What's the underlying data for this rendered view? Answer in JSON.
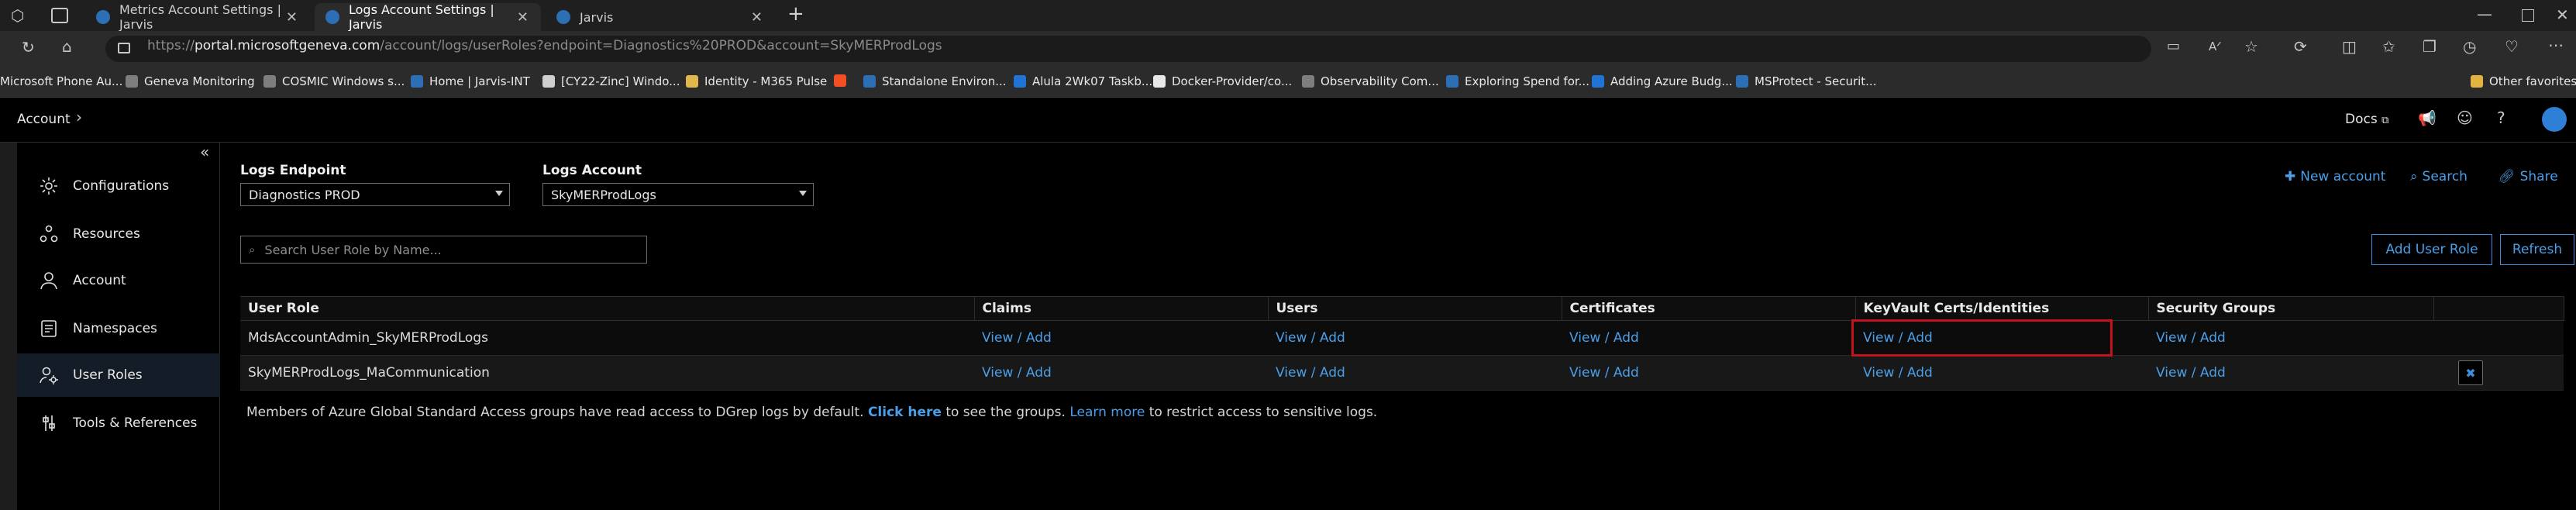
{
  "browser": {
    "tabs": [
      {
        "label": "Metrics Account Settings | Jarvis",
        "active": false
      },
      {
        "label": "Logs Account Settings | Jarvis",
        "active": true
      },
      {
        "label": "Jarvis",
        "active": false
      }
    ],
    "new_tab": "+",
    "url_prefix": "https://",
    "url_host": "portal.microsoftgeneva.com",
    "url_path": "/account/logs/userRoles?endpoint=Diagnostics%20PROD&account=SkyMERProdLogs",
    "favorites": [
      {
        "label": "Microsoft Phone Au...",
        "color": "#d84f2a"
      },
      {
        "label": "Geneva Monitoring",
        "color": "#7e7e7e"
      },
      {
        "label": "COSMIC Windows s...",
        "color": "#7e7e7e"
      },
      {
        "label": "Home | Jarvis-INT",
        "color": "#2d6fb5"
      },
      {
        "label": "[CY22-Zinc] Windo...",
        "color": "#cfcfcf"
      },
      {
        "label": "Identity - M365 Pulse",
        "color": "#e0b94a"
      },
      {
        "label": "",
        "color": "#f25022"
      },
      {
        "label": "Standalone Environ...",
        "color": "#2d6fb5"
      },
      {
        "label": "Alula 2Wk07 Taskb...",
        "color": "#1f74d6"
      },
      {
        "label": "Docker-Provider/co...",
        "color": "#e8e8e8"
      },
      {
        "label": "Observability Com...",
        "color": "#7e7e7e"
      },
      {
        "label": "Exploring Spend for...",
        "color": "#2d6fb5"
      },
      {
        "label": "Adding Azure Budg...",
        "color": "#1f74d6"
      },
      {
        "label": "MSProtect - Securit...",
        "color": "#2d6fb5"
      }
    ],
    "other_favorites": "Other favorites"
  },
  "app": {
    "breadcrumb": "Account",
    "docs": "Docs"
  },
  "sidebar": {
    "collapse": "«",
    "items": [
      {
        "label": "Configurations",
        "icon": "gear-icon",
        "active": false
      },
      {
        "label": "Resources",
        "icon": "resources-icon",
        "active": false
      },
      {
        "label": "Account",
        "icon": "person-icon",
        "active": false
      },
      {
        "label": "Namespaces",
        "icon": "namespaces-icon",
        "active": false
      },
      {
        "label": "User Roles",
        "icon": "user-roles-icon",
        "active": true
      },
      {
        "label": "Tools & References",
        "icon": "tools-icon",
        "active": false
      }
    ]
  },
  "filters": {
    "endpoint_label": "Logs Endpoint",
    "endpoint_value": "Diagnostics PROD",
    "account_label": "Logs Account",
    "account_value": "SkyMERProdLogs"
  },
  "actions": {
    "new_account": "New account",
    "search": "Search",
    "share": "Share"
  },
  "search": {
    "placeholder": "Search User Role by Name..."
  },
  "buttons": {
    "add_user_role": "Add User Role",
    "refresh": "Refresh"
  },
  "table": {
    "columns": [
      "User Role",
      "Claims",
      "Users",
      "Certificates",
      "KeyVault Certs/Identities",
      "Security Groups",
      ""
    ],
    "rows": [
      {
        "role": "MdsAccountAdmin_SkyMERProdLogs",
        "claims": "View / Add",
        "users": "View / Add",
        "certificates": "View / Add",
        "keyvault": "View / Add",
        "security_groups": "View / Add",
        "delete": ""
      },
      {
        "role": "SkyMERProdLogs_MaCommunication",
        "claims": "View / Add",
        "users": "View / Add",
        "certificates": "View / Add",
        "keyvault": "View / Add",
        "security_groups": "View / Add",
        "delete": "✖"
      }
    ]
  },
  "notice": {
    "text1": "Members of Azure Global Standard Access groups have read access to DGrep logs by default. ",
    "link1": "Click here",
    "text2": " to see the groups. ",
    "link2": "Learn more",
    "text3": " to restrict access to sensitive logs."
  },
  "colors": {
    "accent": "#4a9fe8",
    "highlight": "#c2141b",
    "background": "#000000"
  }
}
